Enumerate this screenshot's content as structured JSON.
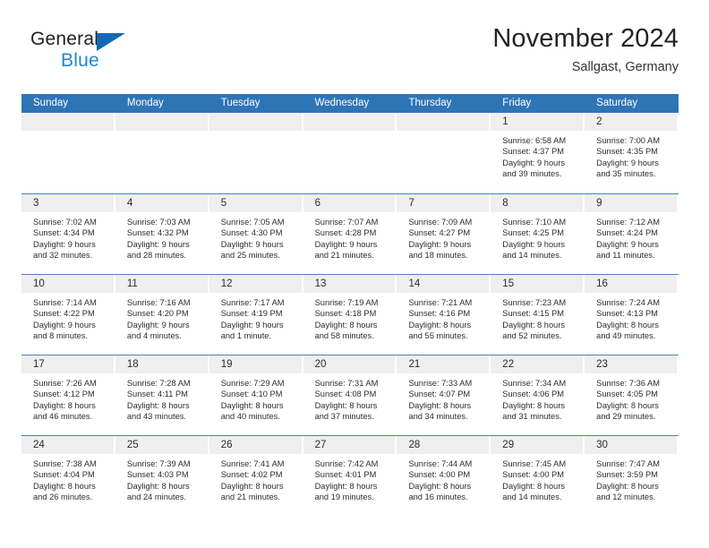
{
  "brand": {
    "word_one": "General",
    "word_two": "Blue",
    "triangle_color": "#1268b3",
    "blue_text_color": "#1b87d4"
  },
  "header": {
    "title": "November 2024",
    "location": "Sallgast, Germany"
  },
  "theme": {
    "header_blue": "#2e75b6",
    "daynum_band": "#efefef",
    "row_divider": "#4a82b8"
  },
  "weekdays": [
    "Sunday",
    "Monday",
    "Tuesday",
    "Wednesday",
    "Thursday",
    "Friday",
    "Saturday"
  ],
  "weeks": [
    [
      {
        "day": "",
        "lines": []
      },
      {
        "day": "",
        "lines": []
      },
      {
        "day": "",
        "lines": []
      },
      {
        "day": "",
        "lines": []
      },
      {
        "day": "",
        "lines": []
      },
      {
        "day": "1",
        "lines": [
          "Sunrise: 6:58 AM",
          "Sunset: 4:37 PM",
          "Daylight: 9 hours",
          "and 39 minutes."
        ]
      },
      {
        "day": "2",
        "lines": [
          "Sunrise: 7:00 AM",
          "Sunset: 4:35 PM",
          "Daylight: 9 hours",
          "and 35 minutes."
        ]
      }
    ],
    [
      {
        "day": "3",
        "lines": [
          "Sunrise: 7:02 AM",
          "Sunset: 4:34 PM",
          "Daylight: 9 hours",
          "and 32 minutes."
        ]
      },
      {
        "day": "4",
        "lines": [
          "Sunrise: 7:03 AM",
          "Sunset: 4:32 PM",
          "Daylight: 9 hours",
          "and 28 minutes."
        ]
      },
      {
        "day": "5",
        "lines": [
          "Sunrise: 7:05 AM",
          "Sunset: 4:30 PM",
          "Daylight: 9 hours",
          "and 25 minutes."
        ]
      },
      {
        "day": "6",
        "lines": [
          "Sunrise: 7:07 AM",
          "Sunset: 4:28 PM",
          "Daylight: 9 hours",
          "and 21 minutes."
        ]
      },
      {
        "day": "7",
        "lines": [
          "Sunrise: 7:09 AM",
          "Sunset: 4:27 PM",
          "Daylight: 9 hours",
          "and 18 minutes."
        ]
      },
      {
        "day": "8",
        "lines": [
          "Sunrise: 7:10 AM",
          "Sunset: 4:25 PM",
          "Daylight: 9 hours",
          "and 14 minutes."
        ]
      },
      {
        "day": "9",
        "lines": [
          "Sunrise: 7:12 AM",
          "Sunset: 4:24 PM",
          "Daylight: 9 hours",
          "and 11 minutes."
        ]
      }
    ],
    [
      {
        "day": "10",
        "lines": [
          "Sunrise: 7:14 AM",
          "Sunset: 4:22 PM",
          "Daylight: 9 hours",
          "and 8 minutes."
        ]
      },
      {
        "day": "11",
        "lines": [
          "Sunrise: 7:16 AM",
          "Sunset: 4:20 PM",
          "Daylight: 9 hours",
          "and 4 minutes."
        ]
      },
      {
        "day": "12",
        "lines": [
          "Sunrise: 7:17 AM",
          "Sunset: 4:19 PM",
          "Daylight: 9 hours",
          "and 1 minute."
        ]
      },
      {
        "day": "13",
        "lines": [
          "Sunrise: 7:19 AM",
          "Sunset: 4:18 PM",
          "Daylight: 8 hours",
          "and 58 minutes."
        ]
      },
      {
        "day": "14",
        "lines": [
          "Sunrise: 7:21 AM",
          "Sunset: 4:16 PM",
          "Daylight: 8 hours",
          "and 55 minutes."
        ]
      },
      {
        "day": "15",
        "lines": [
          "Sunrise: 7:23 AM",
          "Sunset: 4:15 PM",
          "Daylight: 8 hours",
          "and 52 minutes."
        ]
      },
      {
        "day": "16",
        "lines": [
          "Sunrise: 7:24 AM",
          "Sunset: 4:13 PM",
          "Daylight: 8 hours",
          "and 49 minutes."
        ]
      }
    ],
    [
      {
        "day": "17",
        "lines": [
          "Sunrise: 7:26 AM",
          "Sunset: 4:12 PM",
          "Daylight: 8 hours",
          "and 46 minutes."
        ]
      },
      {
        "day": "18",
        "lines": [
          "Sunrise: 7:28 AM",
          "Sunset: 4:11 PM",
          "Daylight: 8 hours",
          "and 43 minutes."
        ]
      },
      {
        "day": "19",
        "lines": [
          "Sunrise: 7:29 AM",
          "Sunset: 4:10 PM",
          "Daylight: 8 hours",
          "and 40 minutes."
        ]
      },
      {
        "day": "20",
        "lines": [
          "Sunrise: 7:31 AM",
          "Sunset: 4:08 PM",
          "Daylight: 8 hours",
          "and 37 minutes."
        ]
      },
      {
        "day": "21",
        "lines": [
          "Sunrise: 7:33 AM",
          "Sunset: 4:07 PM",
          "Daylight: 8 hours",
          "and 34 minutes."
        ]
      },
      {
        "day": "22",
        "lines": [
          "Sunrise: 7:34 AM",
          "Sunset: 4:06 PM",
          "Daylight: 8 hours",
          "and 31 minutes."
        ]
      },
      {
        "day": "23",
        "lines": [
          "Sunrise: 7:36 AM",
          "Sunset: 4:05 PM",
          "Daylight: 8 hours",
          "and 29 minutes."
        ]
      }
    ],
    [
      {
        "day": "24",
        "lines": [
          "Sunrise: 7:38 AM",
          "Sunset: 4:04 PM",
          "Daylight: 8 hours",
          "and 26 minutes."
        ]
      },
      {
        "day": "25",
        "lines": [
          "Sunrise: 7:39 AM",
          "Sunset: 4:03 PM",
          "Daylight: 8 hours",
          "and 24 minutes."
        ]
      },
      {
        "day": "26",
        "lines": [
          "Sunrise: 7:41 AM",
          "Sunset: 4:02 PM",
          "Daylight: 8 hours",
          "and 21 minutes."
        ]
      },
      {
        "day": "27",
        "lines": [
          "Sunrise: 7:42 AM",
          "Sunset: 4:01 PM",
          "Daylight: 8 hours",
          "and 19 minutes."
        ]
      },
      {
        "day": "28",
        "lines": [
          "Sunrise: 7:44 AM",
          "Sunset: 4:00 PM",
          "Daylight: 8 hours",
          "and 16 minutes."
        ]
      },
      {
        "day": "29",
        "lines": [
          "Sunrise: 7:45 AM",
          "Sunset: 4:00 PM",
          "Daylight: 8 hours",
          "and 14 minutes."
        ]
      },
      {
        "day": "30",
        "lines": [
          "Sunrise: 7:47 AM",
          "Sunset: 3:59 PM",
          "Daylight: 8 hours",
          "and 12 minutes."
        ]
      }
    ]
  ]
}
